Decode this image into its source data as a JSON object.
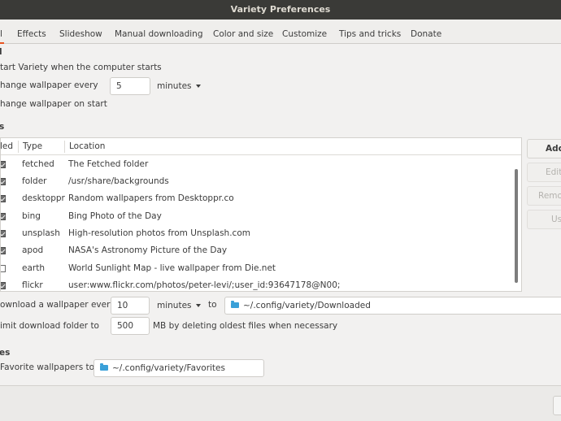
{
  "window": {
    "title": "Variety Preferences"
  },
  "tabs": [
    {
      "label": "l",
      "active": true
    },
    {
      "label": "Effects"
    },
    {
      "label": "Slideshow"
    },
    {
      "label": "Manual downloading"
    },
    {
      "label": "Color and size"
    },
    {
      "label": "Customize"
    },
    {
      "label": "Tips and tricks"
    },
    {
      "label": "Donate"
    }
  ],
  "general": {
    "section_fragment": "l",
    "start_on_login": {
      "label": "tart Variety when the computer starts"
    },
    "change_every": {
      "label": "hange wallpaper every",
      "value": "5",
      "unit": "minutes"
    },
    "change_on_start": {
      "label": "hange wallpaper on start"
    }
  },
  "sources": {
    "section_fragment": "s",
    "columns": {
      "enabled": "led",
      "type": "Type",
      "location": "Location"
    },
    "rows": [
      {
        "type": "fetched",
        "location": "The Fetched folder",
        "checked": true
      },
      {
        "type": "folder",
        "location": "/usr/share/backgrounds",
        "checked": true
      },
      {
        "type": "desktoppr",
        "location": "Random wallpapers from Desktoppr.co",
        "checked": true
      },
      {
        "type": "bing",
        "location": "Bing Photo of the Day",
        "checked": true
      },
      {
        "type": "unsplash",
        "location": "High-resolution photos from Unsplash.com",
        "checked": true
      },
      {
        "type": "apod",
        "location": "NASA's Astronomy Picture of the Day",
        "checked": true
      },
      {
        "type": "earth",
        "location": "World Sunlight Map - live wallpaper from Die.net",
        "checked": false
      },
      {
        "type": "flickr",
        "location": "user:www.flickr.com/photos/peter-levi/;user_id:93647178@N00;",
        "checked": true
      }
    ],
    "buttons": {
      "add": "Add",
      "edit": "Edit",
      "remove": "Remove",
      "use": "Use"
    }
  },
  "download": {
    "every_label": "ownload a wallpaper every",
    "every_value": "10",
    "every_unit": "minutes",
    "to_label": "to",
    "folder": "~/.config/variety/Downloaded",
    "limit_label": "imit download folder to",
    "limit_value": "500",
    "limit_suffix": "MB by deleting oldest files when necessary"
  },
  "favorites": {
    "section_fragment": "es",
    "copy_label": "Favorite wallpapers to",
    "folder": "~/.config/variety/Favorites"
  },
  "icons": {
    "folder": "folder-icon",
    "dropdown": "chevron-down-icon"
  },
  "colors": {
    "accent": "#e95420",
    "titlebar": "#3a3a37",
    "folder": "#3aa0d8"
  }
}
